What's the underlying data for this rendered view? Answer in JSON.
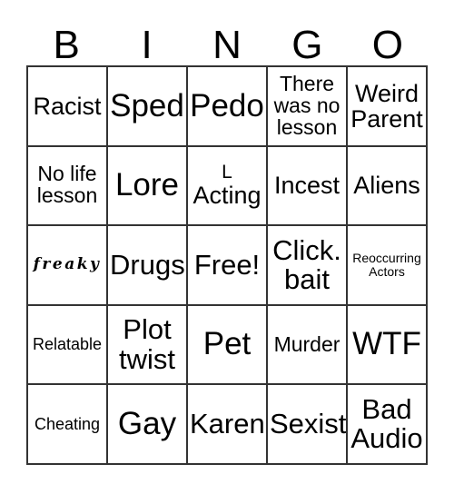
{
  "card": {
    "title": "BINGO",
    "header_letters": [
      "B",
      "I",
      "N",
      "G",
      "O"
    ],
    "colors": {
      "background": "#ffffff",
      "text": "#000000",
      "grid_line": "#333333"
    },
    "grid_size": "5x5",
    "rows": [
      [
        {
          "text": "Racist",
          "size": "lg"
        },
        {
          "text": "Sped",
          "size": "xxl"
        },
        {
          "text": "Pedo",
          "size": "xxl"
        },
        {
          "text": "There\nwas no\nlesson",
          "size": "md"
        },
        {
          "text": "Weird\nParent",
          "size": "lg"
        }
      ],
      [
        {
          "text": "No life\nlesson",
          "size": "md"
        },
        {
          "text": "Lore",
          "size": "xxl"
        },
        {
          "text": "L\nActing",
          "size": "lg",
          "first_line_small": true
        },
        {
          "text": "Incest",
          "size": "lg"
        },
        {
          "text": "Aliens",
          "size": "lg"
        }
      ],
      [
        {
          "text": "freaky",
          "size": "sm",
          "style": "script"
        },
        {
          "text": "Drugs",
          "size": "xl"
        },
        {
          "text": "Free!",
          "size": "xl"
        },
        {
          "text": "Click.\nbait",
          "size": "xl"
        },
        {
          "text": "Reoccurring\nActors",
          "size": "xs"
        }
      ],
      [
        {
          "text": "Relatable",
          "size": "sm"
        },
        {
          "text": "Plot\ntwist",
          "size": "xl"
        },
        {
          "text": "Pet",
          "size": "xxl"
        },
        {
          "text": "Murder",
          "size": "md"
        },
        {
          "text": "WTF",
          "size": "xxl"
        }
      ],
      [
        {
          "text": "Cheating",
          "size": "sm"
        },
        {
          "text": "Gay",
          "size": "xxl"
        },
        {
          "text": "Karen",
          "size": "xl"
        },
        {
          "text": "Sexist",
          "size": "xl"
        },
        {
          "text": "Bad\nAudio",
          "size": "xl"
        }
      ]
    ]
  }
}
